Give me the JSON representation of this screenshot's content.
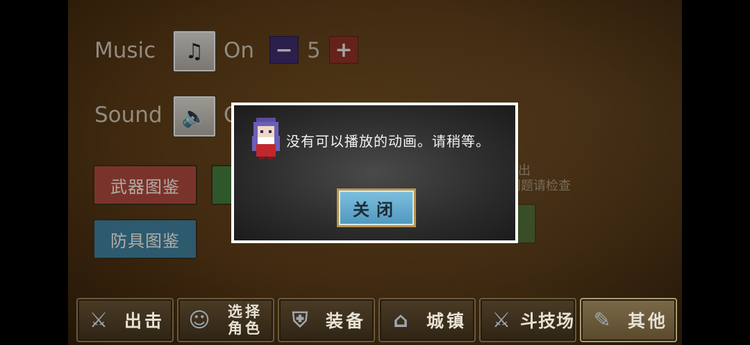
{
  "settings": {
    "music_label": "Music",
    "music_state": "On",
    "music_volume": "5",
    "sound_label": "Sound",
    "sound_state_partial": "O",
    "minus_symbol": "−",
    "plus_symbol": "+"
  },
  "books": {
    "weapons": "武器图鉴",
    "armor": "防具图鉴"
  },
  "partial_text": {
    "line1": "演出",
    "line2": "有问题请检查"
  },
  "dialog": {
    "message": "没有可以播放的动画。请稍等。",
    "close_label": "关闭"
  },
  "tabs": [
    {
      "label": "出击",
      "icon": "sortie-icon"
    },
    {
      "label": "选择角色",
      "icon": "character-select-icon"
    },
    {
      "label": "装备",
      "icon": "equipment-icon"
    },
    {
      "label": "城镇",
      "icon": "town-icon"
    },
    {
      "label": "斗技场",
      "icon": "arena-icon"
    },
    {
      "label": "其他",
      "icon": "other-icon"
    }
  ],
  "colors": {
    "weapons_button": "#a9473c",
    "armor_button": "#3f7d99",
    "close_button": "#6fb2d6",
    "minus_button": "#3a2a6a",
    "plus_button": "#8e2c24"
  }
}
